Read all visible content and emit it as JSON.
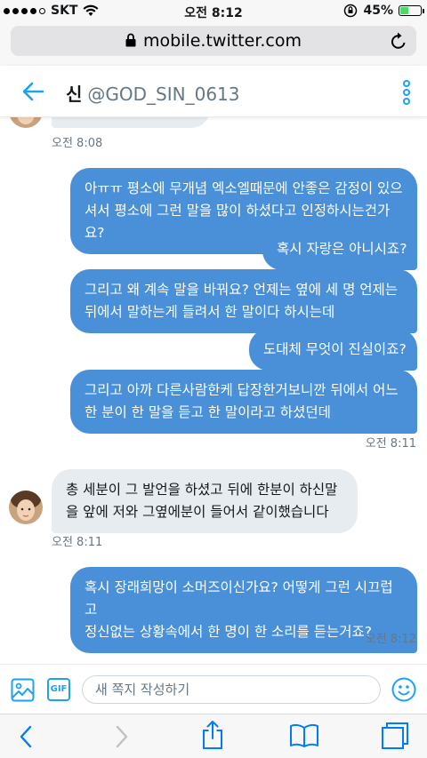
{
  "status_bar": {
    "carrier": "SKT",
    "time": "오전 8:12",
    "battery_percent": "45%",
    "battery_level": 0.45
  },
  "browser": {
    "url": "mobile.twitter.com",
    "lock_icon": "lock-icon",
    "reload_icon": "reload-icon"
  },
  "header": {
    "name": "신",
    "handle": "@GOD_SIN_0613",
    "back_icon": "back-arrow-icon",
    "more_icon": "more-vertical-icon"
  },
  "messages": [
    {
      "id": "m0",
      "direction": "in",
      "text": ""
    },
    {
      "id": "ts0",
      "timestamp": "오전 8:08"
    },
    {
      "id": "m1",
      "direction": "out",
      "lines": [
        "아ㅠㅠ 평소에 무개념 엑소엘때문에 안좋은 감정이 있으",
        "셔서 평소에 그런 말을 많이 하셨다고 인정하시는건가요?"
      ]
    },
    {
      "id": "m2",
      "direction": "out",
      "lines": [
        "혹시 자랑은 아니시죠?"
      ]
    },
    {
      "id": "m3",
      "direction": "out",
      "lines": [
        "그리고 왜 계속 말을 바꿔요? 언제는 옆에 세 명 언제는",
        "뒤에서 말하는게 들려서 한 말이다 하시는데"
      ]
    },
    {
      "id": "m4",
      "direction": "out",
      "lines": [
        "도대체 무엇이 진실이죠?"
      ]
    },
    {
      "id": "m5",
      "direction": "out",
      "lines": [
        "그리고 아까 다른사람한케 답장한거보니깐 뒤에서 어느",
        "한 분이 한 말을 듣고 한 말이라고 하셨던데"
      ]
    },
    {
      "id": "ts1",
      "timestamp": "오전 8:11"
    },
    {
      "id": "m6",
      "direction": "in",
      "lines": [
        "총 세분이 그 발언을 하셨고 뒤에 한분이 하신말",
        "을 앞에 저와 그옆에분이 들어서 같이했습니다"
      ]
    },
    {
      "id": "ts2",
      "timestamp": "오전 8:11"
    },
    {
      "id": "m7",
      "direction": "out",
      "lines": [
        "혹시 장래희망이 소머즈이신가요? 어떻게 그런 시끄럽고",
        "정신없는 상황속에서 한 명이 한 소리를 듣는거죠?"
      ]
    },
    {
      "id": "ts3",
      "timestamp": "오전 8:12"
    }
  ],
  "composer": {
    "placeholder": "새 쪽지 작성하기",
    "gif_label": "GIF",
    "image_icon": "image-icon",
    "emoji_icon": "emoji-icon"
  },
  "toolbar": {
    "icons": [
      "back-chevron-icon",
      "forward-chevron-icon",
      "share-icon",
      "bookmarks-icon",
      "tabs-icon"
    ]
  },
  "colors": {
    "accent": "#1da1f2",
    "outgoing_bubble": "#4a90d9",
    "incoming_bubble": "#e6ecf0",
    "ios_blue": "#007aff"
  }
}
